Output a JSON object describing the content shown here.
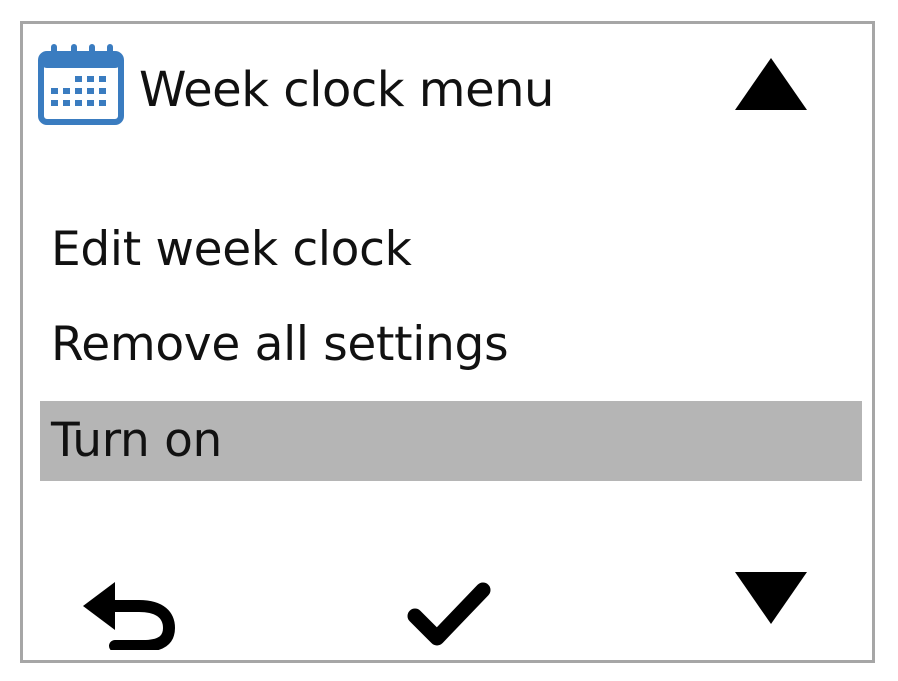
{
  "header": {
    "icon": "calendar-icon",
    "title": "Week clock menu"
  },
  "menu": {
    "items": [
      {
        "label": "Edit week clock",
        "selected": false
      },
      {
        "label": "Remove all settings",
        "selected": false
      },
      {
        "label": "Turn on",
        "selected": true
      }
    ]
  },
  "controls": {
    "scroll_up_icon": "triangle-up-icon",
    "scroll_down_icon": "triangle-down-icon",
    "back_icon": "back-arrow-icon",
    "confirm_icon": "checkmark-icon"
  },
  "colors": {
    "icon_blue": "#3a7cc0",
    "selection": "#b5b5b5",
    "frame": "#a6a6a6"
  }
}
